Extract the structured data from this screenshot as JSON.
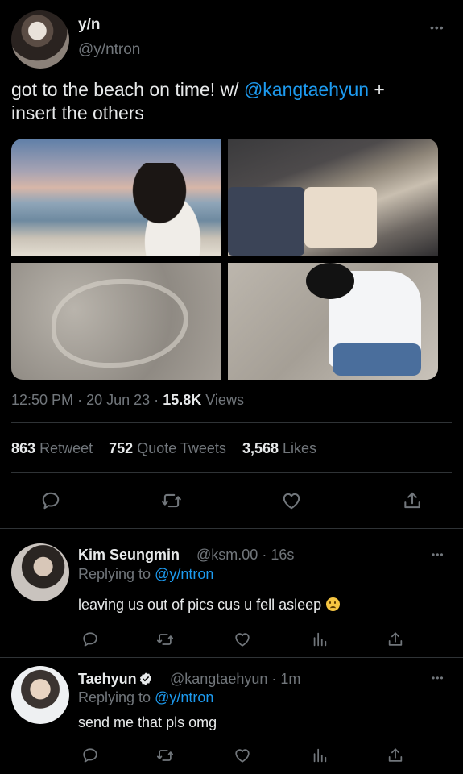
{
  "tweet": {
    "name": "y/n",
    "handle": "@y/ntron",
    "more": "•••",
    "text_before": "got to the beach on time! w/ ",
    "mention": "@kangtaehyun",
    "text_after": " +",
    "text_line2": "insert the others",
    "time": "12:50 PM",
    "date": "20 Jun 23",
    "views_count": "15.8K",
    "views_label": "Views",
    "sep": "·"
  },
  "stats": {
    "retweets_count": "863",
    "retweets_label": "Retweet",
    "quotes_count": "752",
    "quotes_label": "Quote Tweets",
    "likes_count": "3,568",
    "likes_label": "Likes"
  },
  "replies": [
    {
      "name": "Kim Seungmin",
      "handle": "@ksm.00",
      "time": "16s",
      "replying_label": "Replying to",
      "replying_to": "@y/ntron",
      "text": "leaving us out of pics cus u fell asleep",
      "more": "•••"
    },
    {
      "name": "Taehyun",
      "handle": "@kangtaehyun",
      "time": "1m",
      "replying_label": "Replying to",
      "replying_to": "@y/ntron",
      "text": "send me that pls omg",
      "more": "•••"
    }
  ],
  "icons": {
    "reply": "reply-icon",
    "retweet": "retweet-icon",
    "like": "heart-icon",
    "share": "share-icon",
    "analytics": "analytics-icon",
    "verified": "verified-badge-icon",
    "emoji": "frowning-face-emoji"
  },
  "colors": {
    "background": "#000000",
    "text": "#e7e9ea",
    "muted": "#71767b",
    "link": "#1d9bf0",
    "divider": "#2f3336"
  }
}
